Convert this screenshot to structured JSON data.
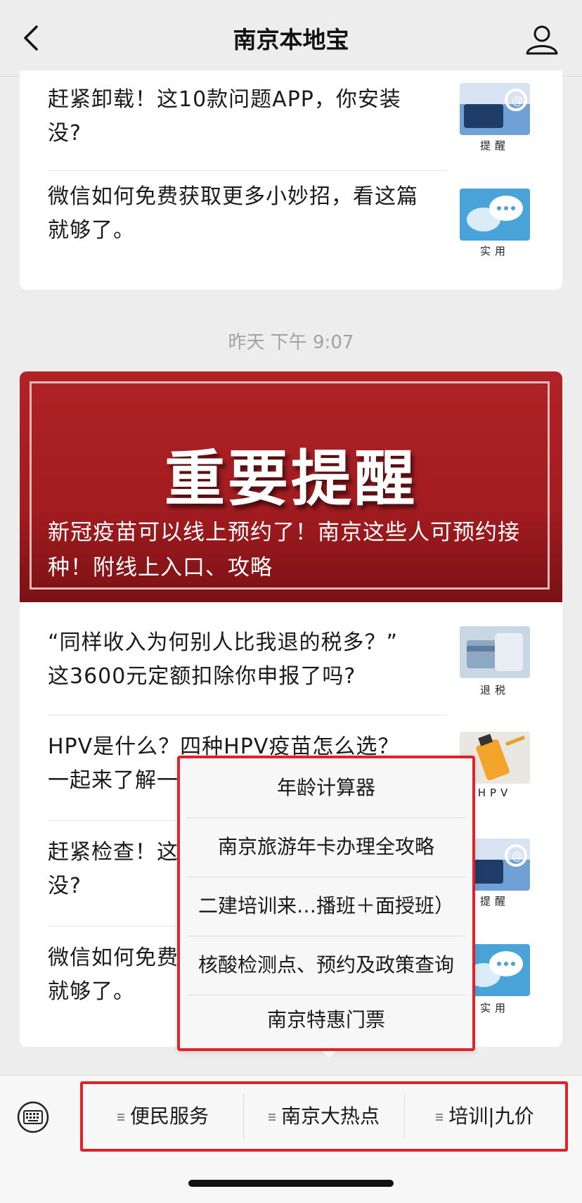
{
  "header": {
    "title": "南京本地宝"
  },
  "top_card": {
    "articles": [
      {
        "title": "赶紧卸载！这10款问题APP，你安装没?",
        "tag": "提醒",
        "thumb_icon": "phone-keyboard-thumbnail"
      },
      {
        "title": "微信如何免费获取更多小妙招，看这篇就够了。",
        "tag": "实用",
        "thumb_icon": "chat-bubbles-thumbnail"
      }
    ]
  },
  "timestamp": "昨天 下午 9:07",
  "main_card": {
    "banner": {
      "headline": "重要提醒",
      "caption": "新冠疫苗可以线上预约了！南京这些人可预约接种！附线上入口、攻略"
    },
    "articles": [
      {
        "title": "“同样收入为何别人比我退的税多？” 这3600元定额扣除你申报了吗?",
        "tag": "退税",
        "thumb_icon": "tax-card-thumbnail"
      },
      {
        "title": "HPV是什么？四种HPV疫苗怎么选？一起来了解一下",
        "tag": "HPV",
        "thumb_icon": "vaccine-bottle-thumbnail"
      },
      {
        "title": "赶紧检查！这10款问题APP，你安装没?",
        "tag": "提醒",
        "thumb_icon": "phone-keyboard-thumbnail"
      },
      {
        "title": "微信如何免费获取更多小妙招，看这篇就够了。",
        "tag": "实用",
        "thumb_icon": "chat-bubbles-thumbnail"
      }
    ]
  },
  "popup_menu": {
    "items": [
      "年龄计算器",
      "南京旅游年卡办理全攻略",
      "二建培训来…播班＋面授班）",
      "核酸检测点、预约及政策查询",
      "南京特惠门票"
    ]
  },
  "bottom_menu": {
    "items": [
      "便民服务",
      "南京大热点",
      "培训|九价"
    ]
  },
  "colors": {
    "highlight": "#e0232b",
    "banner_red": "#a21c20",
    "chat_teal": "#4aa3d8"
  }
}
